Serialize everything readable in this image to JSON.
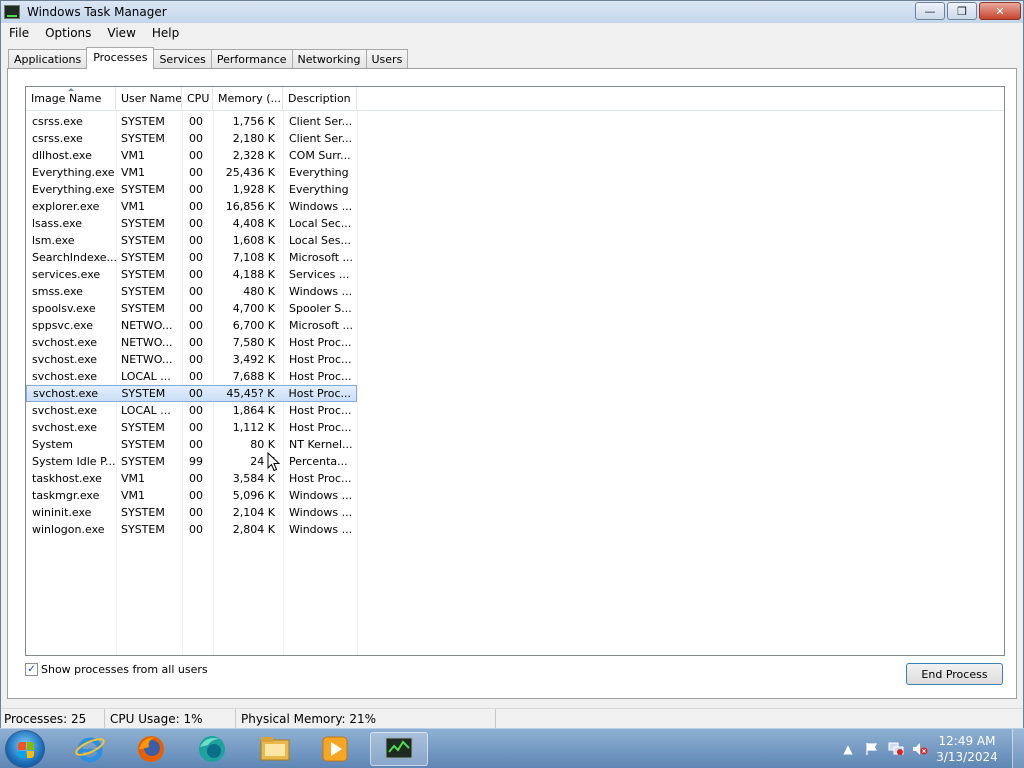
{
  "window": {
    "title": "Windows Task Manager",
    "minimize": "—",
    "maximize": "❐",
    "close": "✕"
  },
  "menu": [
    "File",
    "Options",
    "View",
    "Help"
  ],
  "tabs": [
    "Applications",
    "Processes",
    "Services",
    "Performance",
    "Networking",
    "Users"
  ],
  "active_tab": "Processes",
  "columns": [
    "Image Name",
    "User Name",
    "CPU",
    "Memory (...",
    "Description"
  ],
  "processes": [
    {
      "name": "csrss.exe",
      "user": "SYSTEM",
      "cpu": "00",
      "mem": "1,756 K",
      "desc": "Client Ser..."
    },
    {
      "name": "csrss.exe",
      "user": "SYSTEM",
      "cpu": "00",
      "mem": "2,180 K",
      "desc": "Client Ser..."
    },
    {
      "name": "dllhost.exe",
      "user": "VM1",
      "cpu": "00",
      "mem": "2,328 K",
      "desc": "COM Surr..."
    },
    {
      "name": "Everything.exe",
      "user": "VM1",
      "cpu": "00",
      "mem": "25,436 K",
      "desc": "Everything"
    },
    {
      "name": "Everything.exe",
      "user": "SYSTEM",
      "cpu": "00",
      "mem": "1,928 K",
      "desc": "Everything"
    },
    {
      "name": "explorer.exe",
      "user": "VM1",
      "cpu": "00",
      "mem": "16,856 K",
      "desc": "Windows ..."
    },
    {
      "name": "lsass.exe",
      "user": "SYSTEM",
      "cpu": "00",
      "mem": "4,408 K",
      "desc": "Local Sec..."
    },
    {
      "name": "lsm.exe",
      "user": "SYSTEM",
      "cpu": "00",
      "mem": "1,608 K",
      "desc": "Local Ses..."
    },
    {
      "name": "SearchIndexe...",
      "user": "SYSTEM",
      "cpu": "00",
      "mem": "7,108 K",
      "desc": "Microsoft ..."
    },
    {
      "name": "services.exe",
      "user": "SYSTEM",
      "cpu": "00",
      "mem": "4,188 K",
      "desc": "Services ..."
    },
    {
      "name": "smss.exe",
      "user": "SYSTEM",
      "cpu": "00",
      "mem": "480 K",
      "desc": "Windows ..."
    },
    {
      "name": "spoolsv.exe",
      "user": "SYSTEM",
      "cpu": "00",
      "mem": "4,700 K",
      "desc": "Spooler S..."
    },
    {
      "name": "sppsvc.exe",
      "user": "NETWO...",
      "cpu": "00",
      "mem": "6,700 K",
      "desc": "Microsoft ..."
    },
    {
      "name": "svchost.exe",
      "user": "NETWO...",
      "cpu": "00",
      "mem": "7,580 K",
      "desc": "Host Proc..."
    },
    {
      "name": "svchost.exe",
      "user": "NETWO...",
      "cpu": "00",
      "mem": "3,492 K",
      "desc": "Host Proc..."
    },
    {
      "name": "svchost.exe",
      "user": "LOCAL ...",
      "cpu": "00",
      "mem": "7,688 K",
      "desc": "Host Proc..."
    },
    {
      "name": "svchost.exe",
      "user": "SYSTEM",
      "cpu": "00",
      "mem": "45,45? K",
      "desc": "Host Proc...",
      "selected": true
    },
    {
      "name": "svchost.exe",
      "user": "LOCAL ...",
      "cpu": "00",
      "mem": "1,864 K",
      "desc": "Host Proc..."
    },
    {
      "name": "svchost.exe",
      "user": "SYSTEM",
      "cpu": "00",
      "mem": "1,112 K",
      "desc": "Host Proc..."
    },
    {
      "name": "System",
      "user": "SYSTEM",
      "cpu": "00",
      "mem": "80 K",
      "desc": "NT Kernel..."
    },
    {
      "name": "System Idle P...",
      "user": "SYSTEM",
      "cpu": "99",
      "mem": "24 K",
      "desc": "Percenta..."
    },
    {
      "name": "taskhost.exe",
      "user": "VM1",
      "cpu": "00",
      "mem": "3,584 K",
      "desc": "Host Proc..."
    },
    {
      "name": "taskmgr.exe",
      "user": "VM1",
      "cpu": "00",
      "mem": "5,096 K",
      "desc": "Windows ..."
    },
    {
      "name": "wininit.exe",
      "user": "SYSTEM",
      "cpu": "00",
      "mem": "2,104 K",
      "desc": "Windows ..."
    },
    {
      "name": "winlogon.exe",
      "user": "SYSTEM",
      "cpu": "00",
      "mem": "2,804 K",
      "desc": "Windows ..."
    }
  ],
  "show_all_users": {
    "label": "Show processes from all users",
    "checked": true,
    "mark": "✓"
  },
  "end_process_label": "End Process",
  "status": {
    "processes": "Processes: 25",
    "cpu_usage": "CPU Usage: 1%",
    "physical_memory": "Physical Memory: 21%"
  },
  "taskbar": {
    "icons": [
      "internet-explorer-icon",
      "firefox-icon",
      "edge-like-icon",
      "file-explorer-icon",
      "media-player-icon",
      "task-manager-icon"
    ],
    "time": "12:49 AM",
    "date": "3/13/2024"
  },
  "colors": {
    "selection": "#cce0f7",
    "selection_border": "#84acdd",
    "taskbar": "#6f94c0"
  }
}
